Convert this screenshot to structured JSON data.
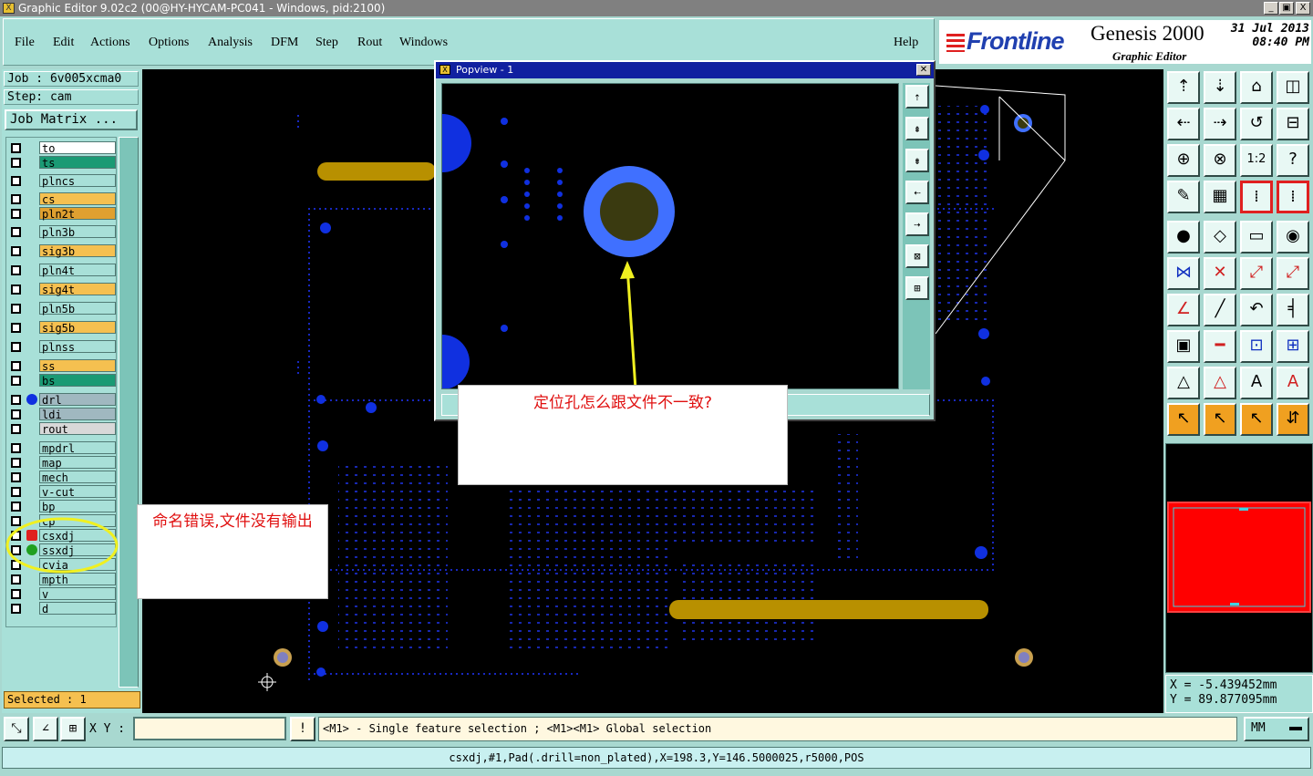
{
  "window": {
    "title": "Graphic Editor 9.02c2 (00@HY-HYCAM-PC041 - Windows, pid:2100)",
    "controls": [
      "_",
      "▣",
      "X"
    ]
  },
  "menu": [
    "File",
    "Edit",
    "Actions",
    "Options",
    "Analysis",
    "DFM",
    "Step",
    "Rout",
    "Windows"
  ],
  "help": "Help",
  "brand": {
    "logo": "Frontline",
    "product": "Genesis 2000",
    "subtitle": "Graphic Editor",
    "date": "31 Jul 2013",
    "time": "08:40 PM"
  },
  "job": {
    "job_label": "Job : 6v005xcma0",
    "step_label": "Step: cam",
    "matrix_button": "Job Matrix ..."
  },
  "layers": [
    {
      "name": "to",
      "color": "#ffffff"
    },
    {
      "name": "ts",
      "color": "#1a9a74"
    },
    {
      "name": "plncs",
      "color": "#a8e0d8"
    },
    {
      "name": "cs",
      "color": "#f5c050"
    },
    {
      "name": "pln2t",
      "color": "#e0a030"
    },
    {
      "name": "pln3b",
      "color": "#a8e0d8"
    },
    {
      "name": "sig3b",
      "color": "#f5c050"
    },
    {
      "name": "pln4t",
      "color": "#a8e0d8"
    },
    {
      "name": "sig4t",
      "color": "#f5c050"
    },
    {
      "name": "pln5b",
      "color": "#a8e0d8"
    },
    {
      "name": "sig5b",
      "color": "#f5c050"
    },
    {
      "name": "plnss",
      "color": "#a8e0d8"
    },
    {
      "name": "ss",
      "color": "#f5c050"
    },
    {
      "name": "bs",
      "color": "#1a9a74"
    },
    {
      "name": "drl",
      "color": "#a0b8c0"
    },
    {
      "name": "ldi",
      "color": "#a0b8c0"
    },
    {
      "name": "rout",
      "color": "#d8d8d8"
    },
    {
      "name": "mpdrl",
      "color": "#a8e0d8"
    },
    {
      "name": "map",
      "color": "#a8e0d8"
    },
    {
      "name": "mech",
      "color": "#a8e0d8"
    },
    {
      "name": "v-cut",
      "color": "#a8e0d8"
    },
    {
      "name": "bp",
      "color": "#a8e0d8"
    },
    {
      "name": "cp",
      "color": "#a8e0d8"
    },
    {
      "name": "csxdj",
      "color": "#a8e0d8"
    },
    {
      "name": "ssxdj",
      "color": "#a8e0d8"
    },
    {
      "name": "cvia",
      "color": "#a8e0d8"
    },
    {
      "name": "mpth",
      "color": "#a8e0d8"
    },
    {
      "name": "v",
      "color": "#a8e0d8"
    },
    {
      "name": "d",
      "color": "#a8e0d8"
    }
  ],
  "selected": "Selected : 1",
  "popview": {
    "title": "Popview - 1"
  },
  "annotations": {
    "popview_note": "定位孔怎么跟文件不一致?",
    "layer_note": "命名错误,文件没有输出"
  },
  "coords": {
    "x": "X = -5.439452mm",
    "y": "Y = 89.877095mm"
  },
  "command": {
    "xy_label": "X Y :",
    "xy_value": "",
    "prompt_icon": "!",
    "prompt": "<M1> - Single feature selection ; <M1><M1> Global selection",
    "units": "MM"
  },
  "status": "csxdj,#1,Pad(.drill=non_plated),X=198.3,Y=146.5000025,r5000,POS",
  "colors": {
    "pad_blue": "#1030e0",
    "trace_gold": "#b89000",
    "highlight_red": "#ff0000",
    "annotation_red": "#e01010",
    "circle_yellow": "#f0f020"
  },
  "toolbar_icons": [
    "zoom-home-icon",
    "zoom-fit-icon",
    "home-icon",
    "window-icon",
    "pan-left-icon",
    "pan-right-icon",
    "undo-icon",
    "step-icon",
    "zoom-in-icon",
    "zoom-center-icon",
    "one-to-one-icon",
    "help-icon",
    "measure-icon",
    "grid-icon",
    "snap-icon",
    "snap-alt-icon",
    "pad-icon",
    "line-icon",
    "ruler-icon",
    "dot-icon",
    "net-icon",
    "cross-icon",
    "link-icon",
    "link-alt-icon",
    "angle-icon",
    "slash-icon",
    "arc-icon",
    "text-icon",
    "layer-icon",
    "line-red-icon",
    "dimension-icon",
    "multi-icon",
    "triangle-icon",
    "triangle-red-icon",
    "a-icon",
    "a-red-icon",
    "select-icon",
    "select-alt-icon",
    "select-box-icon",
    "route-icon"
  ]
}
